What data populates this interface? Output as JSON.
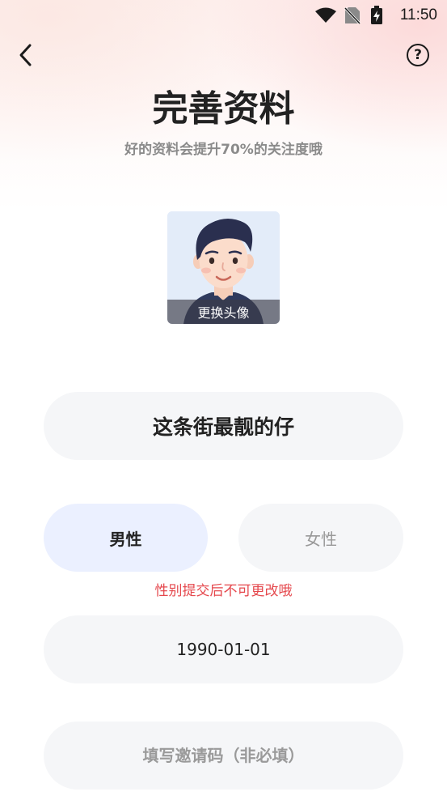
{
  "status_bar": {
    "time": "11:50",
    "icons": [
      "wifi-icon",
      "no-sim-icon",
      "battery-charging-icon"
    ]
  },
  "header": {
    "back_icon": "back-arrow-icon",
    "help_icon": "help-question-icon",
    "help_glyph": "?"
  },
  "title": "完善资料",
  "subtitle": "好的资料会提升70%的关注度哦",
  "avatar": {
    "change_label": "更换头像"
  },
  "form": {
    "nickname": "这条街最靓的仔",
    "gender": {
      "male_label": "男性",
      "female_label": "女性",
      "selected": "male",
      "warning": "性别提交后不可更改哦"
    },
    "birthday": "1990-01-01",
    "invite_placeholder": "填写邀请码（非必填）"
  },
  "colors": {
    "selected_bg": "#ebf0ff",
    "field_bg": "#f5f6f8",
    "warning": "#e5484d"
  }
}
